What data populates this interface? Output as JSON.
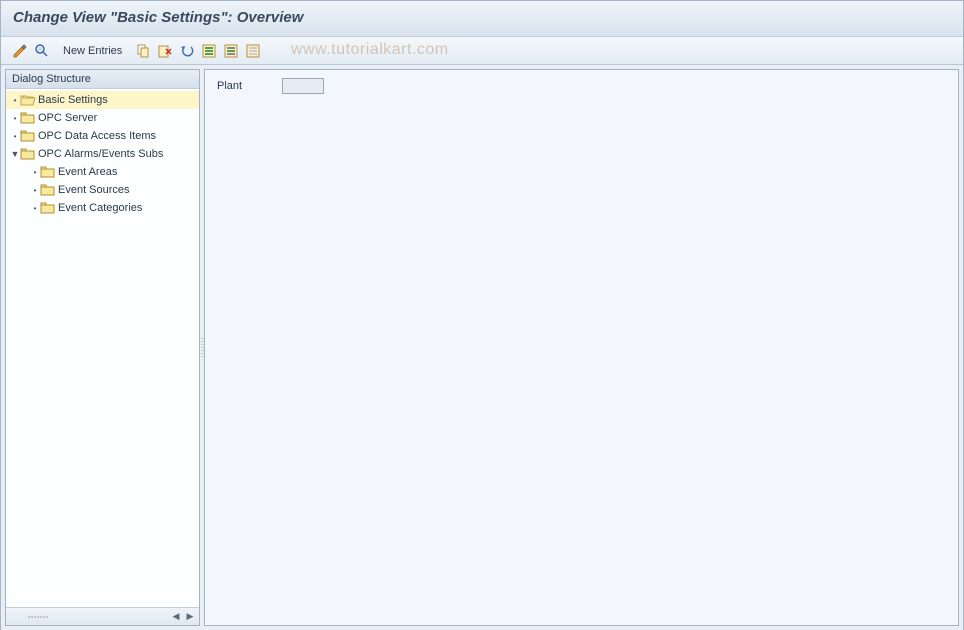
{
  "title": "Change View \"Basic Settings\": Overview",
  "toolbar": {
    "new_entries": "New Entries"
  },
  "watermark": "www.tutorialkart.com",
  "sidebar": {
    "header": "Dialog Structure",
    "nodes": {
      "basic_settings": "Basic Settings",
      "opc_server": "OPC Server",
      "opc_data_access": "OPC Data Access Items",
      "opc_alarms": "OPC Alarms/Events Subs",
      "event_areas": "Event Areas",
      "event_sources": "Event Sources",
      "event_categories": "Event Categories"
    }
  },
  "main": {
    "plant_label": "Plant",
    "plant_value": ""
  }
}
